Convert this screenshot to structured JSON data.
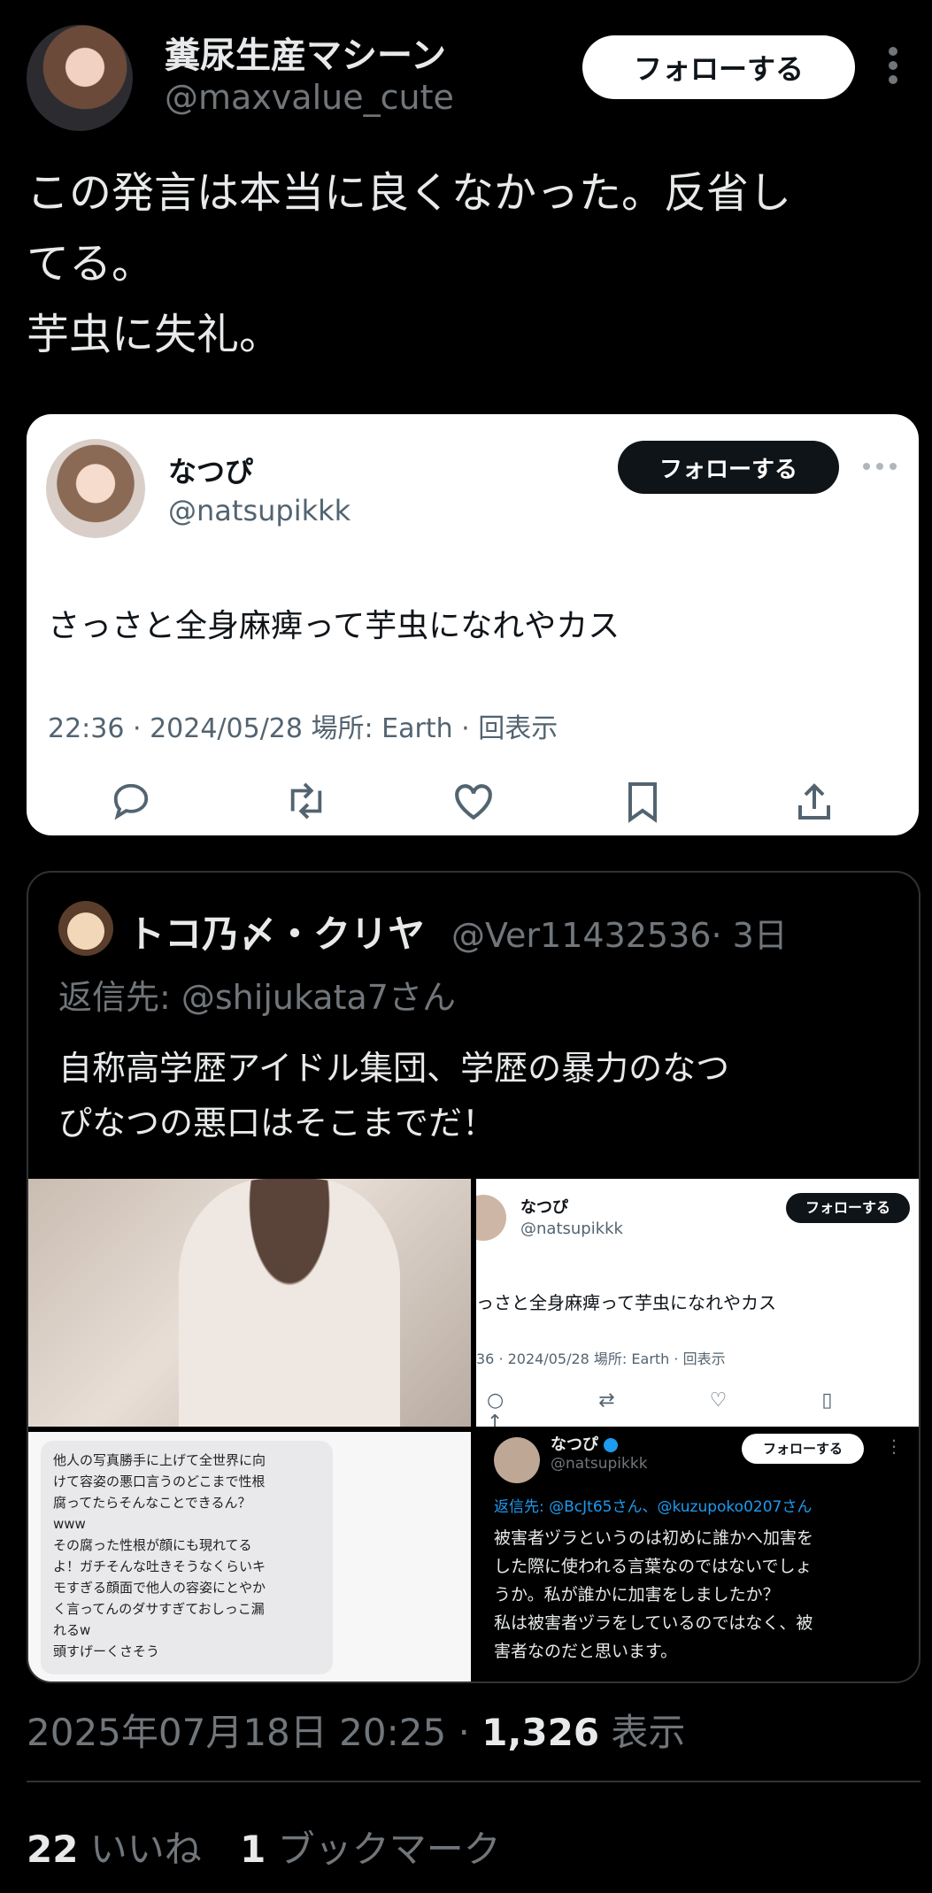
{
  "header": {
    "display_name": "糞尿生産マシーン",
    "handle": "@maxvalue_cute",
    "follow_label": "フォローする"
  },
  "tweet": {
    "lines": [
      "この発言は本当に良くなかった。反省し",
      "てる。",
      "芋虫に失礼。"
    ]
  },
  "quoted": {
    "display_name": "なつぴ",
    "handle": "@natsupikkk",
    "follow_label": "フォローする",
    "text": "さっさと全身麻痺って芋虫になれやカス",
    "meta": "22:36 · 2024/05/28 場所: Earth · 回表示"
  },
  "reply": {
    "display_name": "トコ乃〆・クリヤ",
    "handle": "@Ver11432536",
    "age": "· 3日",
    "reply_to": "返信先: @shijukata7さん",
    "lines": [
      "自称高学歴アイドル集団、学歴の暴力のなつ",
      "ぴなつの悪口はそこまでだ！"
    ],
    "mini_quote": {
      "display_name": "なつぴ",
      "handle": "@natsupikkk",
      "follow_label": "フォローする",
      "text": "っさと全身麻痺って芋虫になれやカス",
      "meta": "36 · 2024/05/28 場所: Earth · 回表示"
    },
    "note_text": [
      "他人の写真勝手に上げて全世界に向",
      "けて容姿の悪口言うのどこまで性根",
      "腐ってたらそんなことできるん？",
      "www",
      "その腐った性根が顔にも現れてる",
      "よ！ガチそんな吐きそうなくらいキ",
      "モすぎる顔面で他人の容姿にとやか",
      "く言ってんのダサすぎておしっこ漏",
      "れるw",
      "頭すげーくさそう"
    ],
    "dark_reply": {
      "display_name": "なつぴ",
      "handle": "@natsupikkk",
      "follow_label": "フォローする",
      "reply_to": "返信先: @BcJt65さん、@kuzupoko0207さん",
      "lines": [
        "被害者ヅラというのは初めに誰かへ加害を",
        "した際に使われる言葉なのではないでしょ",
        "うか。私が誰かに加害をしましたか？",
        "私は被害者ヅラをしているのではなく、被",
        "害者なのだと思います。"
      ]
    }
  },
  "footer": {
    "timestamp": "2025年07月18日 20:25 · ",
    "views_count": "1,326",
    "views_label": " 表示",
    "likes_count": "22",
    "likes_label": " いいね",
    "bookmarks_count": "1",
    "bookmarks_label": " ブックマーク"
  },
  "colors": {
    "link": "#1d9bf0",
    "verified": "#1d9bf0"
  }
}
